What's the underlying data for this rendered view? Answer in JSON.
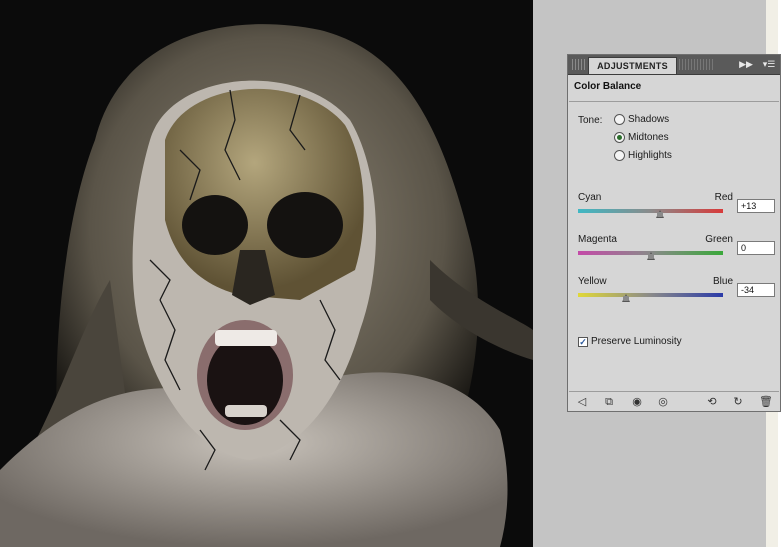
{
  "panel": {
    "tab_label": "ADJUSTMENTS",
    "collapse_icon": "double-arrow-icon",
    "menu_icon": "panel-menu-icon",
    "title": "Color Balance",
    "tone_label": "Tone:",
    "tones": [
      {
        "label": "Shadows",
        "selected": false
      },
      {
        "label": "Midtones",
        "selected": true
      },
      {
        "label": "Highlights",
        "selected": false
      }
    ],
    "sliders": [
      {
        "left": "Cyan",
        "right": "Red",
        "value": "+13",
        "numeric": 13,
        "left_color": "#3fb8c4",
        "right_color": "#d83a3a"
      },
      {
        "left": "Magenta",
        "right": "Green",
        "value": "0",
        "numeric": 0,
        "left_color": "#c44aa8",
        "right_color": "#3aa83a"
      },
      {
        "left": "Yellow",
        "right": "Blue",
        "value": "-34",
        "numeric": -34,
        "left_color": "#e0d838",
        "right_color": "#2a3aa8"
      }
    ],
    "slider_range": [
      -100,
      100
    ],
    "preserve_luminosity": {
      "label": "Preserve Luminosity",
      "checked": true
    },
    "bottom_tools": [
      "back-arrow-icon",
      "clip-layer-icon",
      "visibility-eye-icon",
      "view-previous-icon",
      "reset-icon",
      "delete-icon"
    ]
  }
}
